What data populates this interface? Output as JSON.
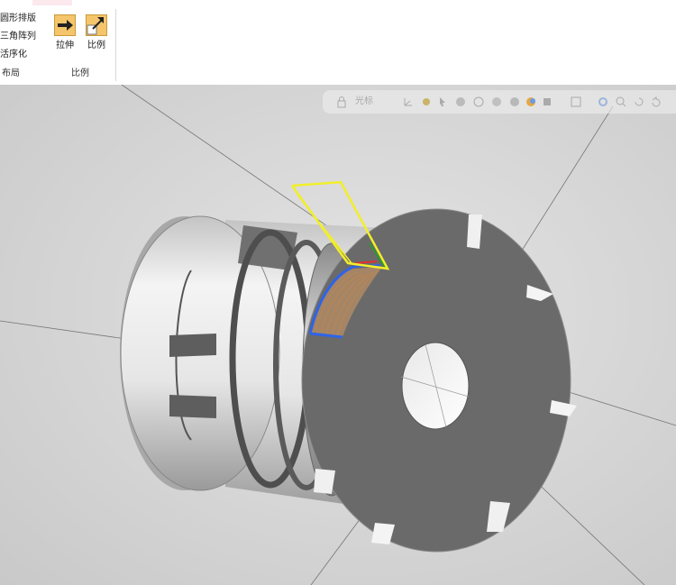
{
  "ribbon": {
    "layout_items": [
      "圆形排版",
      "三角阵列",
      "活序化"
    ],
    "layout_group_label": "布局",
    "stretch_label": "拉伸",
    "scale_label": "比例",
    "scale_group_label": "比例"
  },
  "view_toolbar": {
    "dropdown_text": "光标",
    "icons": [
      "lock-icon",
      "view-orient-icon",
      "axes-icon",
      "smart-snap-icon",
      "pointer-icon",
      "shaded-icon",
      "wireframe-icon",
      "render-icon",
      "lighting-icon",
      "color-icon",
      "section-view-icon",
      "display-box-icon",
      "settings-icon",
      "zoom-icon",
      "rotate-icon",
      "undo-view-icon"
    ]
  },
  "colors": {
    "viewport_bg": "#d6d6d6",
    "part_face": "#6a6a6a",
    "part_body": "#ececec",
    "selection_yellow": "#f2ee2a",
    "selection_blue": "#2f64e8",
    "toolpath_orange": "#c8864a"
  }
}
